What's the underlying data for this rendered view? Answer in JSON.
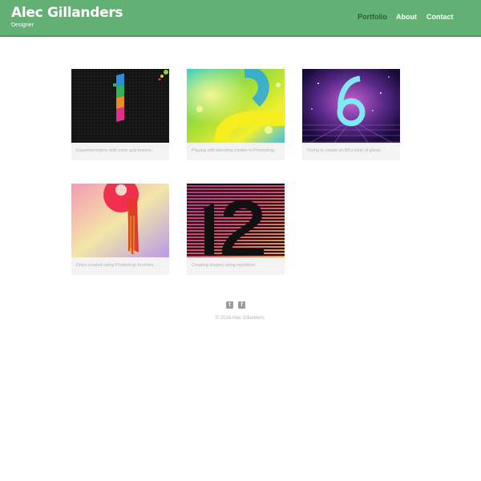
{
  "header": {
    "brand": "Alec Gillanders",
    "tagline": "Designer",
    "nav": [
      {
        "label": "Portfolio",
        "active": true
      },
      {
        "label": "About",
        "active": false
      },
      {
        "label": "Contact",
        "active": false
      }
    ]
  },
  "portfolio": {
    "items": [
      {
        "caption": "Experimentation with color and texture.",
        "thumb": "artwork-number-1"
      },
      {
        "caption": "Playing with blending modes in Photoshop.",
        "thumb": "artwork-number-2"
      },
      {
        "caption": "Trying to create an 80's style of glows.",
        "thumb": "artwork-number-6"
      },
      {
        "caption": "Drips created using Photoshop brushes.",
        "thumb": "artwork-number-9-drips"
      },
      {
        "caption": "Creating shapes using repetition.",
        "thumb": "artwork-number-12"
      }
    ]
  },
  "footer": {
    "social": [
      {
        "name": "twitter-icon",
        "glyph": "t"
      },
      {
        "name": "facebook-icon",
        "glyph": "f"
      }
    ],
    "copyright": "© 2016 Alec Gillanders."
  },
  "colors": {
    "header_bg": "#63b074",
    "nav_active": "#2f5e3a",
    "card_bg": "#f3f3f3",
    "caption_text": "#b3b3b3"
  }
}
